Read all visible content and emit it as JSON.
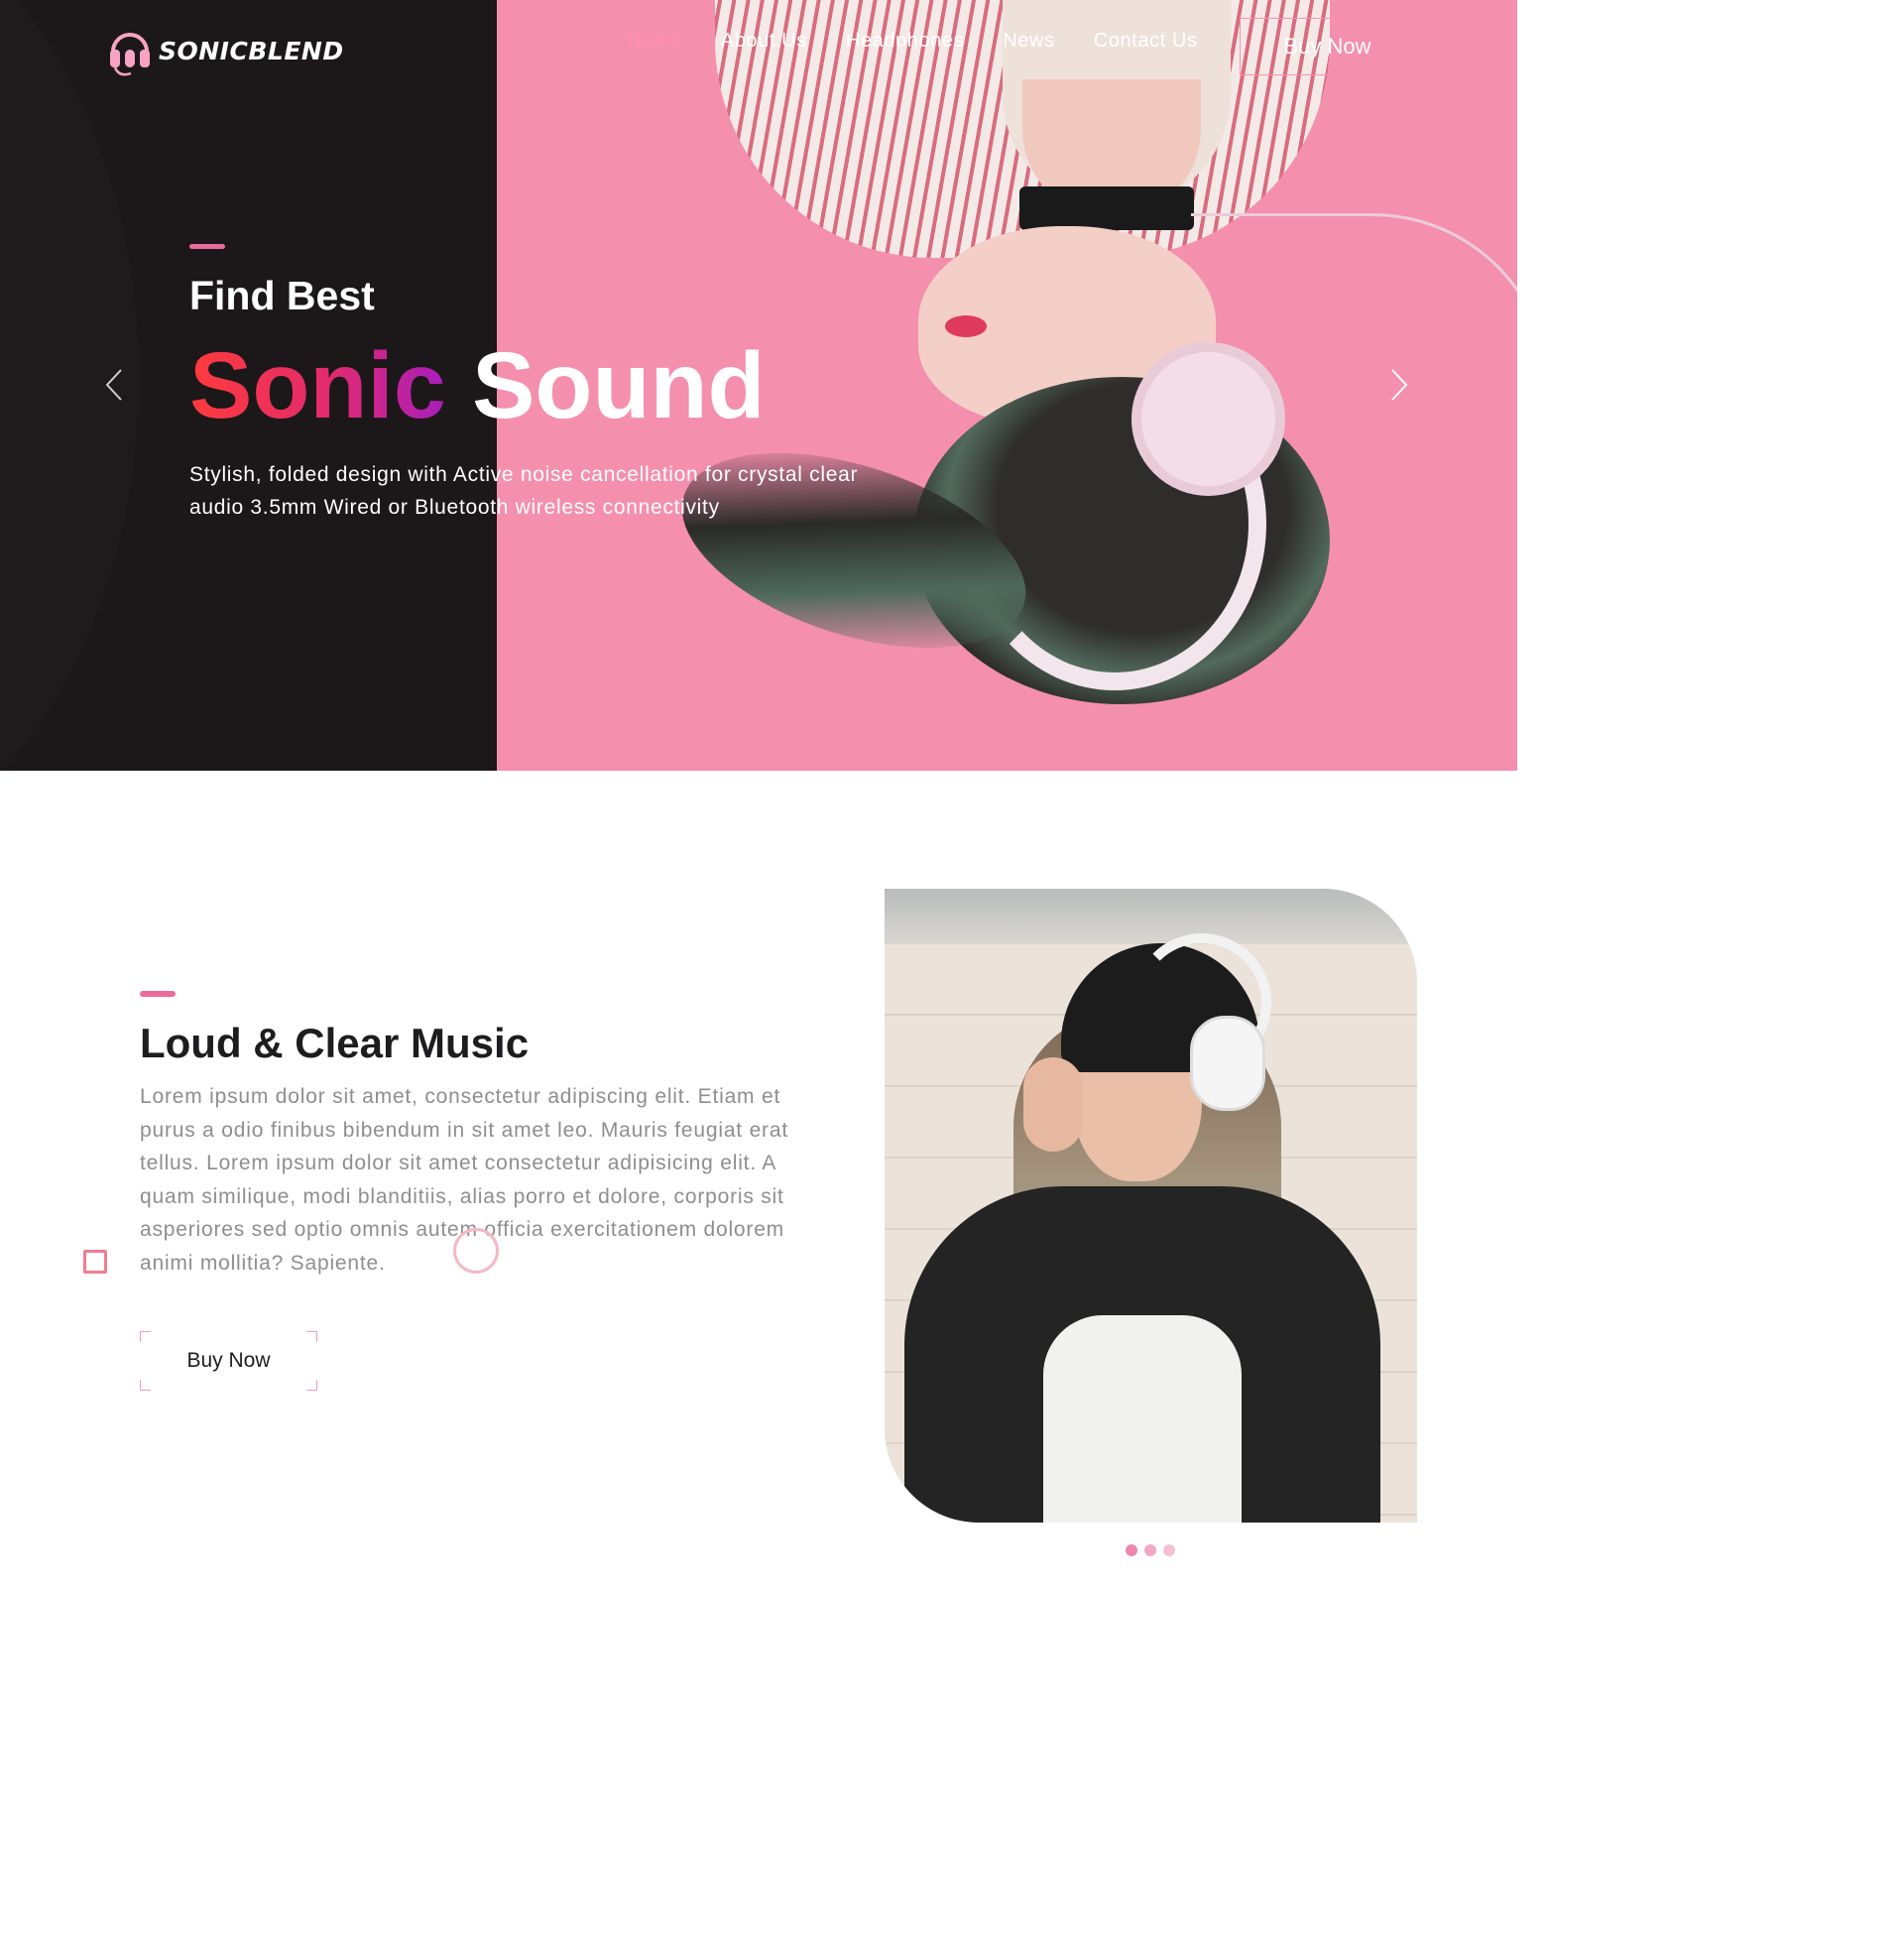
{
  "brand": {
    "name": "SONICBLEND",
    "logo_icon": "headphones-icon",
    "accent": "#ea6c9a"
  },
  "nav": {
    "items": [
      {
        "label": "Home",
        "active": true
      },
      {
        "label": "About Us",
        "active": false
      },
      {
        "label": "Headphones",
        "active": false
      },
      {
        "label": "News",
        "active": false
      },
      {
        "label": "Contact Us",
        "active": false
      }
    ],
    "cta_label": "Buy Now"
  },
  "hero": {
    "kicker": "Find Best",
    "title_highlight": "Sonic",
    "title_rest": "Sound",
    "description": "Stylish, folded design with Active noise cancellation for crystal clear audio 3.5mm Wired or Bluetooth wireless connectivity",
    "prev_icon": "chevron-left-icon",
    "next_icon": "chevron-right-icon"
  },
  "about": {
    "title": "Loud & Clear Music",
    "body": "Lorem ipsum dolor sit amet, consectetur adipiscing elit. Etiam et purus a odio finibus bibendum in sit amet leo. Mauris feugiat erat tellus. Lorem ipsum dolor sit amet consectetur adipisicing elit. A quam similique, modi blanditiis, alias porro et dolore, corporis sit asperiores sed optio omnis autem officia exercitationem dolorem animi mollitia? Sapiente.",
    "button_label": "Buy Now"
  }
}
